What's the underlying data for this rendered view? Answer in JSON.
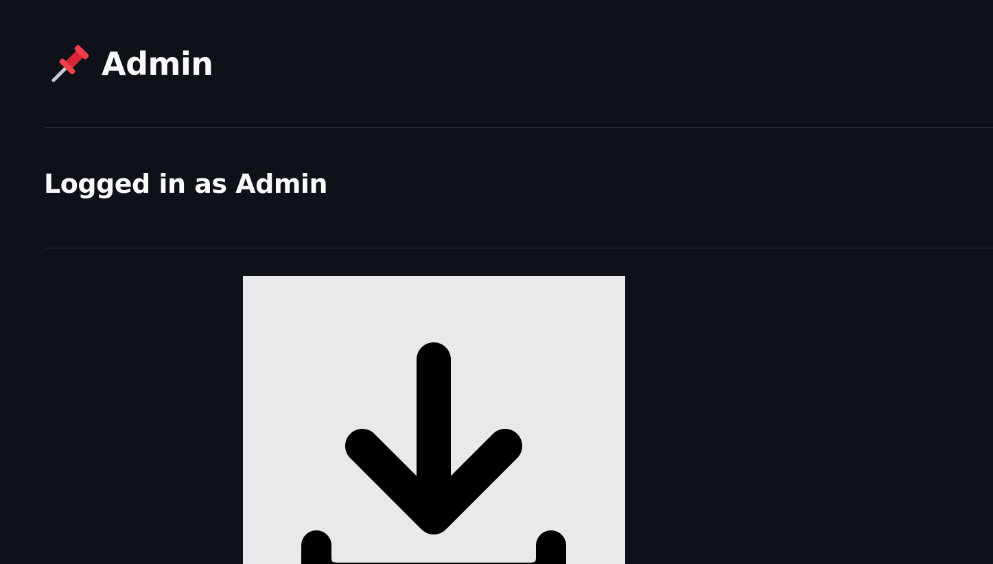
{
  "header": {
    "icon": "pushpin-icon",
    "title": "Admin"
  },
  "main": {
    "subtitle": "Logged in as Admin",
    "image": {
      "icon": "download-icon",
      "background_color": "#e8e9eb"
    }
  },
  "colors": {
    "background": "#0e1117",
    "text": "#fafafa",
    "divider": "#31333f",
    "pin_red": "#e8333f"
  }
}
